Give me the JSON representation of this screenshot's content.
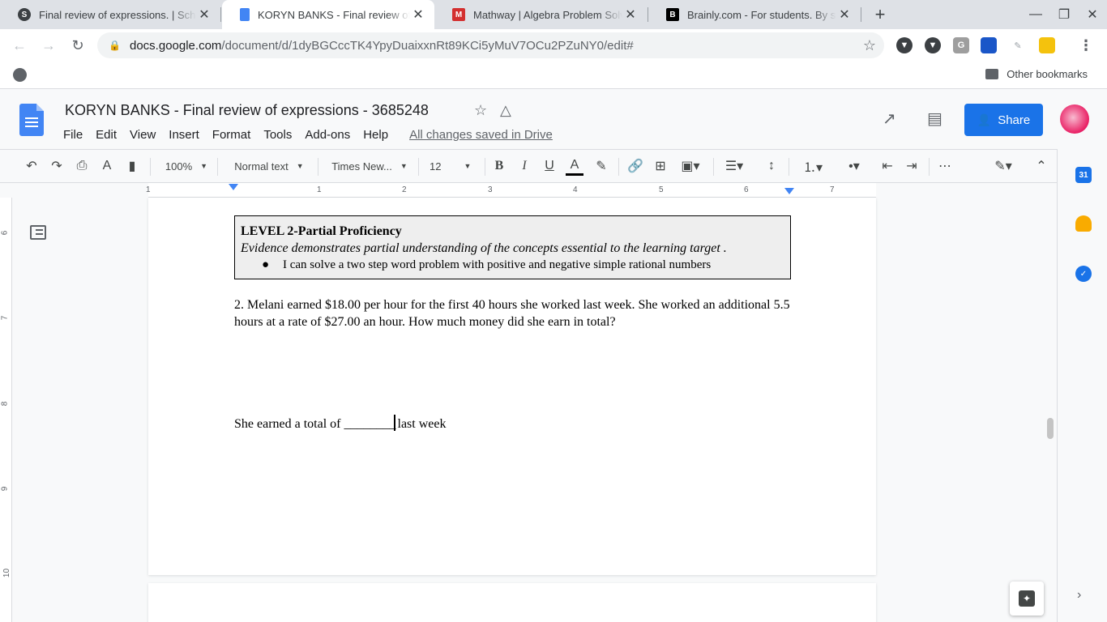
{
  "browser": {
    "tabs": [
      {
        "favicon": "S",
        "title": "Final review of expressions. | Sch"
      },
      {
        "favicon": "docs",
        "title": "KORYN BANKS - Final review of e"
      },
      {
        "favicon": "M",
        "title": "Mathway | Algebra Problem Solver"
      },
      {
        "favicon": "B",
        "title": "Brainly.com - For students. By stu"
      }
    ],
    "url_host": "docs.google.com",
    "url_path": "/document/d/1dyBGCccTK4YpyDuaixxnRt89KCi5yMuV7OCu2PZuNY0/edit#",
    "bookmarks_other": "Other bookmarks"
  },
  "docs": {
    "title": "KORYN BANKS - Final review of expressions - 3685248",
    "menu": [
      "File",
      "Edit",
      "View",
      "Insert",
      "Format",
      "Tools",
      "Add-ons",
      "Help"
    ],
    "saved_status": "All changes saved in Drive",
    "share_label": "Share",
    "toolbar": {
      "zoom": "100%",
      "style": "Normal text",
      "font": "Times New...",
      "size": "12"
    },
    "ruler_h": [
      "1",
      "1",
      "2",
      "3",
      "4",
      "5",
      "6",
      "7"
    ],
    "ruler_v": [
      "6",
      "7",
      "8",
      "9",
      "10"
    ]
  },
  "content": {
    "level_title": "LEVEL 2-Partial Proficiency",
    "level_desc": "Evidence demonstrates partial understanding of the concepts essential to the learning target .",
    "level_bullet": "I can solve a two step word problem with positive and negative simple rational numbers",
    "question": "2. Melani earned $18.00 per hour for the first 40 hours she worked last week. She worked an additional 5.5 hours at a rate of $27.00 an hour. How much money did she earn in total?",
    "answer_before": "She earned a total of ________",
    "answer_after": "last week"
  },
  "colors": {
    "share_blue": "#1a73e8",
    "docs_blue": "#4285f4",
    "box_fill": "#eeeeee"
  }
}
